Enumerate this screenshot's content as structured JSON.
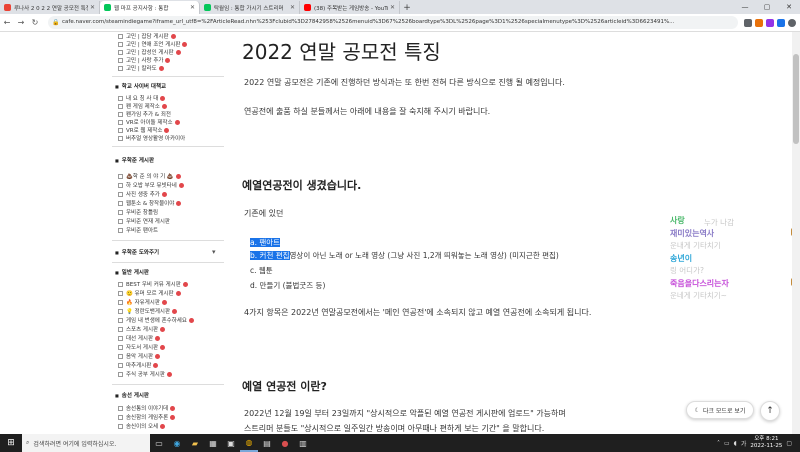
{
  "tabs": [
    {
      "title": "루나사 2 0 2 2 연말 공모전 특징",
      "color": "#ea4335",
      "active": false
    },
    {
      "title": "웹 마프 공지사항 : 통합",
      "color": "#03c75a",
      "active": true
    },
    {
      "title": "탁월임 : 통합 가시기 스트리머",
      "color": "#03c75a",
      "active": false
    },
    {
      "title": "(38) 주목받는 게임방송 - YouTube",
      "color": "#ff0000",
      "active": false
    }
  ],
  "window_controls": [
    "—",
    "▢",
    "✕"
  ],
  "url": "cafe.naver.com/steamindiegame?iframe_url_utf8=%2FArticleRead.nhn%253Fclubid%3D27842958%2526menuid%3D67%2526boardtype%3DL%2526page%3D1%2526specialmenutype%3D%2526articleid%3D6623491%...",
  "sidebar": {
    "items_top": [
      "고민 | 잡담 게시판",
      "고민 | 연애 조언 게시판",
      "고민 | 잡성인 게시판",
      "고민 | 사랑 추가",
      "고민 | 칼라도"
    ],
    "section1": "학교 사이버 대책교",
    "section1_items": [
      "내 요 칭 사 대",
      "펜 게임 제작소",
      "펜가임 추가 & 죄전",
      "VR로 아이돌 제작소",
      "VR로 웹 제작소",
      "버추얼 영상활영 아카이아"
    ],
    "section2": "우학준 게시판",
    "section2_items": [
      "💩학 준 의 야 기 💩",
      "하 오밥 부모 뮤빗타네",
      "사진 생중 추가",
      "웹툰소 & 창작물이야",
      "우비준 창틀림",
      "우비준 연재 게시판",
      "우비준 팬아트"
    ],
    "section3": "우학준 도와주기",
    "section4": "일반 게시판",
    "section4_items": [
      "BEST 우비 커뮤 게시판",
      "🙂 유머 모르 게시판",
      "🔥 자유게시판",
      "💡 정란도밴게시판",
      "게임 내 번생에 혼수하세요",
      "스포츠 게시판",
      "대선 게시판",
      "자도서 게시판",
      "음악 게시판",
      "마추게시판",
      "주식 공부 게시판"
    ],
    "section5": "솜선 게시판",
    "section5_items": [
      "솜선통의 이야기데",
      "솜신함의 게임추론",
      "솜신이의 오세"
    ]
  },
  "article": {
    "title": "2022 연말 공모전 특징",
    "p1": "2022 연말 공모전은 기존에 진행하던 방식과는 또 한번 전혀 다른 방식으로 진행 될 예정입니다.",
    "p2": "연공전에 출품 하실 분들께서는 아래에 내용을 잘 숙지해 주시기 바랍니다.",
    "h1": "예열연공전이 생겼습니다.",
    "p3": "기존에 있던",
    "list": [
      {
        "prefix": "a.",
        "text": "팬아트",
        "rest": "",
        "selected": true
      },
      {
        "prefix": "b.",
        "text": "커천 편집",
        "rest": "영상이 아닌 노래 or 노래 영상 (그냥 사진 1,2개 띄워놓는 노래 영상) (미지근한 편집)",
        "selected": true
      },
      {
        "prefix": "c.",
        "text": "웹툰",
        "rest": "",
        "selected": false
      },
      {
        "prefix": "d.",
        "text": "만들기 (불법굿즈 등)",
        "rest": "",
        "selected": false
      }
    ],
    "p4": "4가지 항목은 2022년 연말공모전에서는 '메인 연공전'에 소속되지 않고 예열 연공전에 소속되게 됩니다.",
    "h2": "예열 연공전 이란?",
    "p5": "2022년 12월 19일 부터 23일까지 \"상시적으로 악플된 예열 연공전 게시판에 업로드\" 가능하며",
    "p6": "스트리머 분들도 \"상시적으로 일주일간 방송이며 아무때나 편하게 보는 기간\" 을 말합니다."
  },
  "chat": [
    {
      "name": "사랑",
      "msg": "누가 나감",
      "color": "#49b86a"
    },
    {
      "name": "재미있는역사",
      "msg": "운내게 기타치기",
      "color": "#8b7cc7"
    },
    {
      "name": "송년이",
      "msg": "링 어디가?",
      "color": "#2fa7d8"
    },
    {
      "name": "죽음을다스리는자",
      "msg": "운네게 기타치기~",
      "color": "#c64fd9"
    }
  ],
  "darkmode_label": "다크 모드로 보기",
  "top_label": "↑",
  "taskbar": {
    "search_placeholder": "검색하려면 여기에 입력하십시오.",
    "time": "오후 8:21",
    "date": "2022-11-25"
  }
}
